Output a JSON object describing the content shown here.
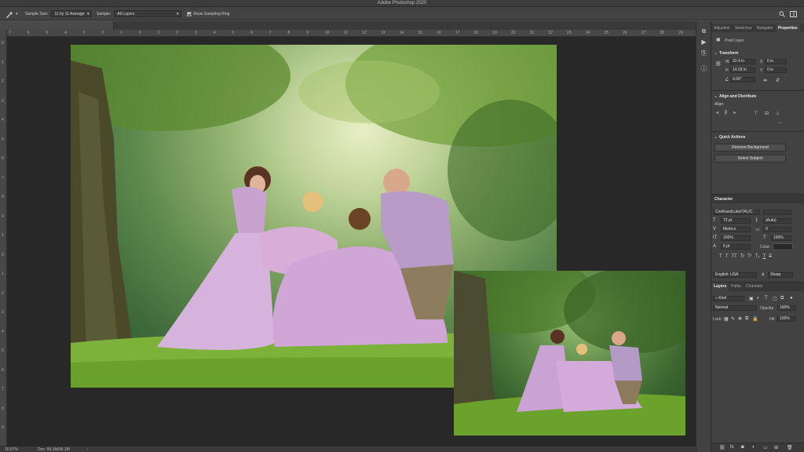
{
  "app": {
    "title": "Adobe Photoshop 2020"
  },
  "options": {
    "sample_size_label": "Sample Size:",
    "sample_size_value": "11 by 11 Average",
    "sample_label": "Sample:",
    "sample_value": "All Layers",
    "show_ring_label": "Show Sampling Ring"
  },
  "rulers": {
    "h": [
      "7",
      "6",
      "5",
      "4",
      "3",
      "2",
      "1",
      "0",
      "1",
      "2",
      "3",
      "4",
      "5",
      "6",
      "7",
      "8",
      "9",
      "10",
      "11",
      "12",
      "13",
      "14",
      "15",
      "16",
      "17",
      "18",
      "19",
      "20",
      "21",
      "22",
      "23",
      "24",
      "25",
      "26",
      "27",
      "28",
      "29"
    ],
    "v": [
      "0",
      "1",
      "2",
      "3",
      "4",
      "5",
      "6",
      "7",
      "8",
      "9",
      "1",
      "0",
      "1",
      "2",
      "3",
      "4",
      "5",
      "6",
      "7",
      "8",
      "9"
    ]
  },
  "status": {
    "zoom": "16.67%",
    "doc": "Doc: 95.1M/95.1M"
  },
  "panel": {
    "tabs": [
      "Adjustme",
      "Swatches",
      "Navigator",
      "Properties"
    ],
    "layer_type": "Pixel Layer",
    "transform": {
      "title": "Transform",
      "w_label": "W",
      "w_value": "22.4 in",
      "x_label": "X",
      "x_value": "0 in",
      "h_label": "H",
      "h_value": "14.93 in",
      "y_label": "Y",
      "y_value": "0 in",
      "angle_value": "0.00°"
    },
    "align": {
      "title": "Align and Distribute",
      "align_label": "Align:"
    },
    "quick": {
      "title": "Quick Actions",
      "remove_bg": "Remove Background",
      "select_subject": "Select Subject"
    },
    "character": {
      "title": "Character",
      "font": "CoolhandLukeITALIC",
      "size": "72 pt",
      "leading": "(Auto)",
      "kerning": "Metrics",
      "tracking": "0",
      "vscale": "100%",
      "hscale": "100%",
      "baseline": "0 pt",
      "color_label": "Color:",
      "language": "English: USA",
      "aa": "Sharp",
      "style_buttons": [
        "T",
        "T",
        "TT",
        "Tr",
        "T¹",
        "T₁",
        "T",
        "T"
      ]
    },
    "layers": {
      "tabs": [
        "Layers",
        "Paths",
        "Channels"
      ],
      "kind": "Kind",
      "blend": "Normal",
      "opacity_label": "Opacity:",
      "opacity_value": "100%",
      "lock_label": "Lock:",
      "fill_label": "Fill:",
      "fill_value": "100%"
    }
  },
  "colors": {
    "ui_dark": "#282828",
    "ui_panel": "#424242",
    "ui_bar": "#434343"
  }
}
